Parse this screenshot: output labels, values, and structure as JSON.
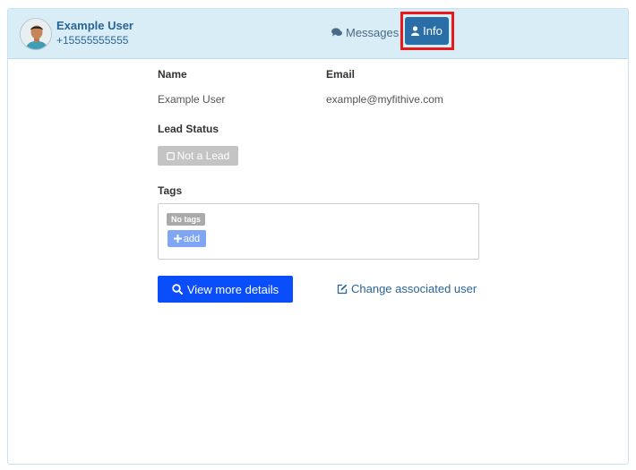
{
  "header": {
    "user_name": "Example User",
    "user_phone": "+15555555555",
    "tabs": {
      "messages": {
        "label": "Messages",
        "icon": "comments-icon"
      },
      "info": {
        "label": "Info",
        "icon": "user-icon",
        "active": true
      }
    }
  },
  "details": {
    "name_label": "Name",
    "name_value": "Example User",
    "email_label": "Email",
    "email_value": "example@myfithive.com",
    "lead_status_label": "Lead Status",
    "lead_status_button": "Not a Lead",
    "tags_label": "Tags",
    "no_tags_badge": "No tags",
    "add_tag_button": "add"
  },
  "actions": {
    "view_more_details": "View more details",
    "change_associated_user": "Change associated user"
  },
  "colors": {
    "header_bg": "#d9edf7",
    "primary_button": "#0a4dfa",
    "active_tab": "#2a6ea8",
    "highlight": "#e8191b",
    "link": "#2a6496"
  }
}
